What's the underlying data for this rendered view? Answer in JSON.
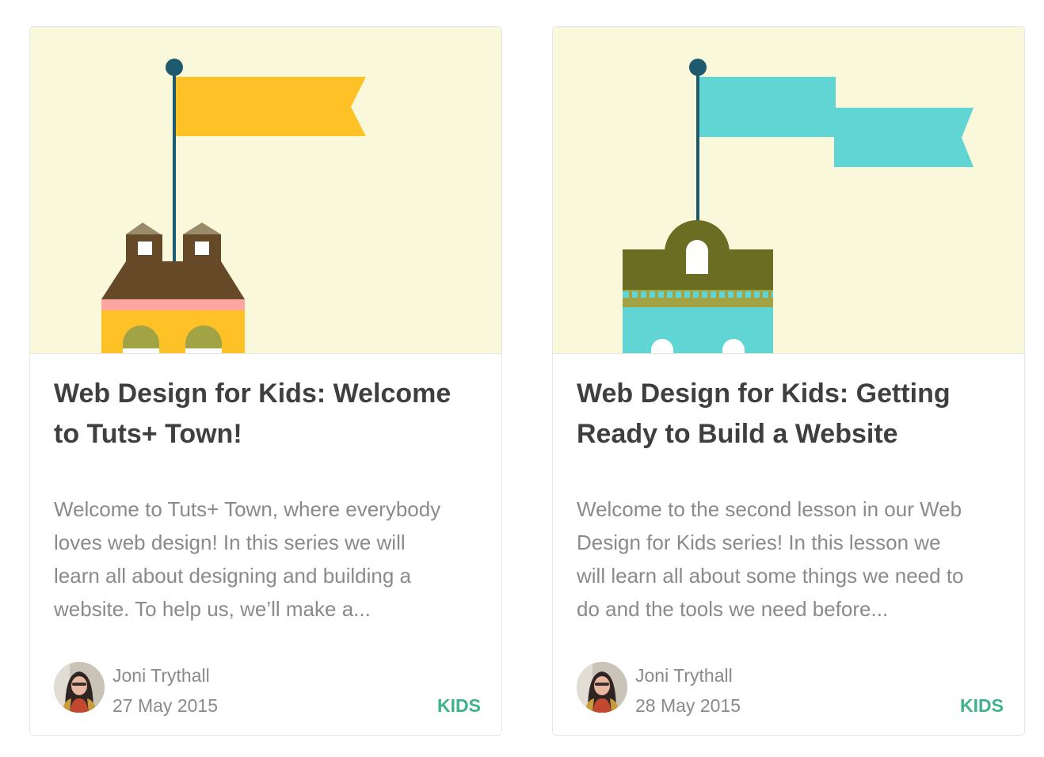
{
  "colors": {
    "category": "#3db28c",
    "hero_background": "#f9f8da",
    "title": "#3f3f3f",
    "excerpt": "#8a8a8a"
  },
  "cards": [
    {
      "title_line1": "Web Design for Kids: Welcome",
      "title_line2": "to Tuts+ Town!",
      "excerpt_line1": "Welcome to Tuts+ Town, where everybody",
      "excerpt_line2": "loves web design! In this series we will",
      "excerpt_line3": "learn all about designing and building a",
      "excerpt_line4": "website. To help us, we’ll make a...",
      "author": "Joni Trythall",
      "date": "27 May 2015",
      "category": "KIDS",
      "hero_icon": "yellow-flag-house-illustration",
      "avatar_icon": "author-avatar"
    },
    {
      "title_line1": "Web Design for Kids: Getting",
      "title_line2": "Ready to Build a Website",
      "excerpt_line1": "Welcome to the second lesson in our Web",
      "excerpt_line2": "Design for Kids series! In this lesson we",
      "excerpt_line3": "will learn all about some things we need to",
      "excerpt_line4": "do and the tools we need before...",
      "author": "Joni Trythall",
      "date": "28 May 2015",
      "category": "KIDS",
      "hero_icon": "teal-flag-tower-illustration",
      "avatar_icon": "author-avatar"
    }
  ]
}
